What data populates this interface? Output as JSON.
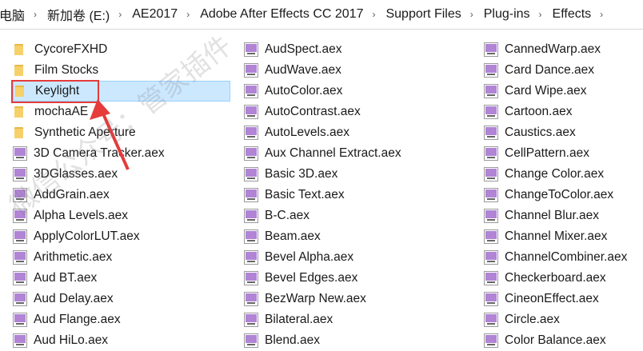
{
  "address_bar": {
    "crumbs": [
      "电脑",
      "新加卷 (E:)",
      "AE2017",
      "Adobe After Effects CC 2017",
      "Support Files",
      "Plug-ins",
      "Effects"
    ]
  },
  "files": {
    "col1": [
      {
        "name": "CycoreFXHD",
        "type": "folder"
      },
      {
        "name": "Film Stocks",
        "type": "folder"
      },
      {
        "name": "Keylight",
        "type": "folder",
        "selected": true
      },
      {
        "name": "mochaAE",
        "type": "folder"
      },
      {
        "name": "Synthetic Aperture",
        "type": "folder"
      },
      {
        "name": "3D Camera Tracker.aex",
        "type": "aex"
      },
      {
        "name": "3DGlasses.aex",
        "type": "aex"
      },
      {
        "name": "AddGrain.aex",
        "type": "aex"
      },
      {
        "name": "Alpha Levels.aex",
        "type": "aex"
      },
      {
        "name": "ApplyColorLUT.aex",
        "type": "aex"
      },
      {
        "name": "Arithmetic.aex",
        "type": "aex"
      },
      {
        "name": "Aud BT.aex",
        "type": "aex"
      },
      {
        "name": "Aud Delay.aex",
        "type": "aex"
      },
      {
        "name": "Aud Flange.aex",
        "type": "aex"
      },
      {
        "name": "Aud HiLo.aex",
        "type": "aex"
      }
    ],
    "col2": [
      {
        "name": "AudSpect.aex",
        "type": "aex"
      },
      {
        "name": "AudWave.aex",
        "type": "aex"
      },
      {
        "name": "AutoColor.aex",
        "type": "aex"
      },
      {
        "name": "AutoContrast.aex",
        "type": "aex"
      },
      {
        "name": "AutoLevels.aex",
        "type": "aex"
      },
      {
        "name": "Aux Channel Extract.aex",
        "type": "aex"
      },
      {
        "name": "Basic 3D.aex",
        "type": "aex"
      },
      {
        "name": "Basic Text.aex",
        "type": "aex"
      },
      {
        "name": "B-C.aex",
        "type": "aex"
      },
      {
        "name": "Beam.aex",
        "type": "aex"
      },
      {
        "name": "Bevel Alpha.aex",
        "type": "aex"
      },
      {
        "name": "Bevel Edges.aex",
        "type": "aex"
      },
      {
        "name": "BezWarp New.aex",
        "type": "aex"
      },
      {
        "name": "Bilateral.aex",
        "type": "aex"
      },
      {
        "name": "Blend.aex",
        "type": "aex"
      }
    ],
    "col3": [
      {
        "name": "CannedWarp.aex",
        "type": "aex"
      },
      {
        "name": "Card Dance.aex",
        "type": "aex"
      },
      {
        "name": "Card Wipe.aex",
        "type": "aex"
      },
      {
        "name": "Cartoon.aex",
        "type": "aex"
      },
      {
        "name": "Caustics.aex",
        "type": "aex"
      },
      {
        "name": "CellPattern.aex",
        "type": "aex"
      },
      {
        "name": "Change Color.aex",
        "type": "aex"
      },
      {
        "name": "ChangeToColor.aex",
        "type": "aex"
      },
      {
        "name": "Channel Blur.aex",
        "type": "aex"
      },
      {
        "name": "Channel Mixer.aex",
        "type": "aex"
      },
      {
        "name": "ChannelCombiner.aex",
        "type": "aex"
      },
      {
        "name": "Checkerboard.aex",
        "type": "aex"
      },
      {
        "name": "CineonEffect.aex",
        "type": "aex"
      },
      {
        "name": "Circle.aex",
        "type": "aex"
      },
      {
        "name": "Color Balance.aex",
        "type": "aex"
      }
    ]
  },
  "watermark": "微信公众号：管家插件",
  "colors": {
    "selection": "#cce8ff",
    "highlight": "#e53b3b",
    "folder": "#f6d16a",
    "plugin": "#b184d6"
  }
}
